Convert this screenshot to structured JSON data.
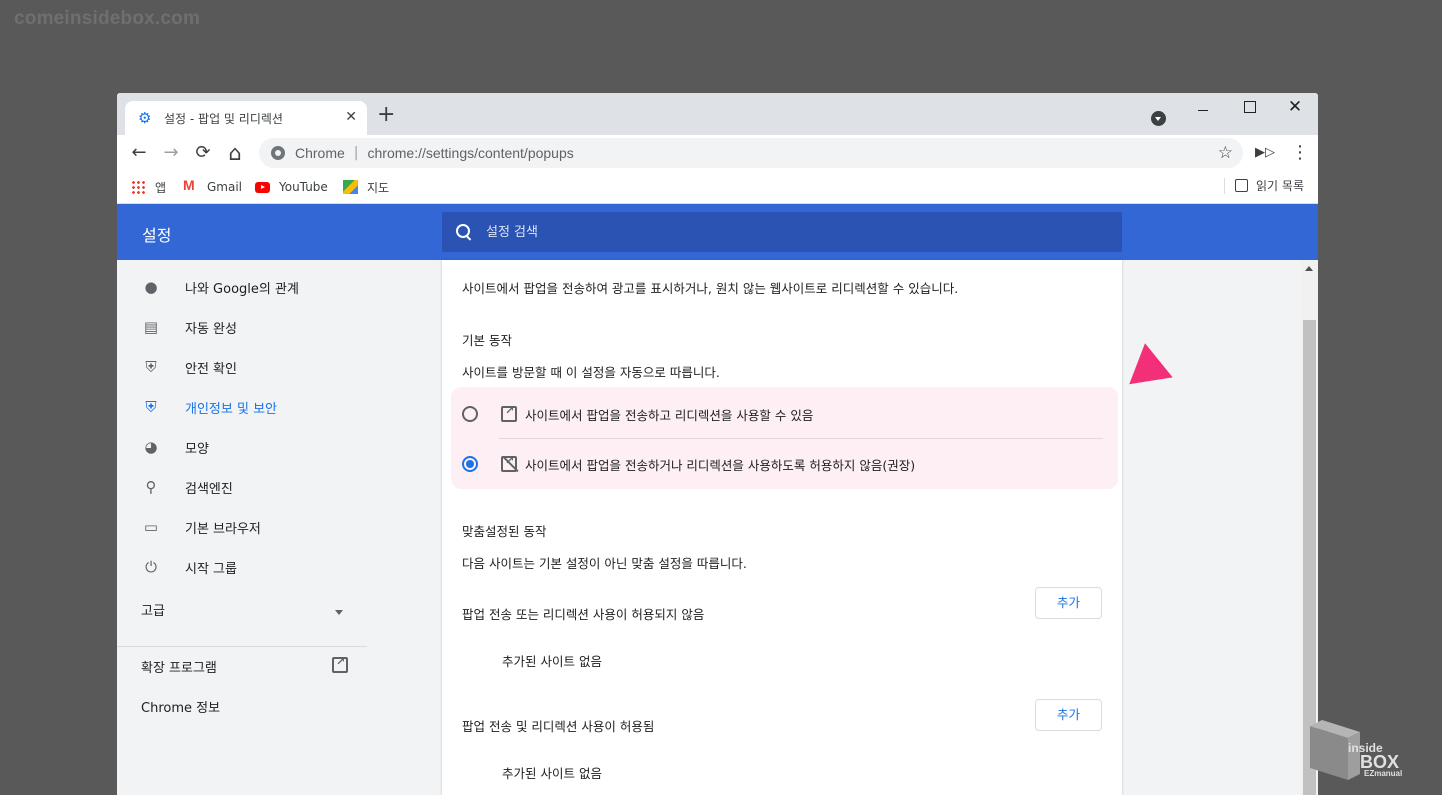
{
  "watermark": "comeinsidebox.com",
  "tab": {
    "title": "설정 - 팝업 및 리디렉션",
    "close": "✕",
    "new_tab": "+"
  },
  "window_controls": {
    "close": "✕"
  },
  "toolbar": {
    "back": "←",
    "forward": "→",
    "reload": "⟳",
    "home": "⌂",
    "scheme_label": "Chrome",
    "separator": "|",
    "url": "chrome://settings/content/popups",
    "star": "☆",
    "menu": "⋮"
  },
  "bookmarks": {
    "items": [
      {
        "label": "앱",
        "icon": "apps-icon"
      },
      {
        "label": "Gmail",
        "icon": "gmail-icon"
      },
      {
        "label": "YouTube",
        "icon": "youtube-icon"
      },
      {
        "label": "지도",
        "icon": "maps-icon"
      }
    ],
    "reading_list": "읽기 목록"
  },
  "header": {
    "title": "설정",
    "search_placeholder": "설정 검색"
  },
  "sidebar": {
    "items": [
      {
        "label": "나와 Google의 관계",
        "icon": "👤",
        "active": false
      },
      {
        "label": "자동 완성",
        "icon": "📋",
        "active": false
      },
      {
        "label": "안전 확인",
        "icon": "🛡",
        "active": false
      },
      {
        "label": "개인정보 및 보안",
        "icon": "🛡",
        "active": true
      },
      {
        "label": "모양",
        "icon": "🎨",
        "active": false
      },
      {
        "label": "검색엔진",
        "icon": "🔍",
        "active": false
      },
      {
        "label": "기본 브라우저",
        "icon": "▭",
        "active": false
      },
      {
        "label": "시작 그룹",
        "icon": "⏻",
        "active": false
      }
    ],
    "advanced": "고급",
    "extensions": "확장 프로그램",
    "about": "Chrome 정보"
  },
  "main": {
    "description": "사이트에서 팝업을 전송하여 광고를 표시하거나, 원치 않는 웹사이트로 리디렉션할 수 있습니다.",
    "default_heading": "기본 동작",
    "default_desc": "사이트를 방문할 때 이 설정을 자동으로 따릅니다.",
    "options": [
      {
        "label": "사이트에서 팝업을 전송하고 리디렉션을 사용할 수 있음",
        "checked": false
      },
      {
        "label": "사이트에서 팝업을 전송하거나 리디렉션을 사용하도록 허용하지 않음(권장)",
        "checked": true
      }
    ],
    "custom_heading": "맞춤설정된 동작",
    "custom_desc": "다음 사이트는 기본 설정이 아닌 맞춤 설정을 따릅니다.",
    "blocked_section": {
      "title": "팝업 전송 또는 리디렉션 사용이 허용되지 않음",
      "add_label": "추가",
      "empty": "추가된 사이트 없음"
    },
    "allowed_section": {
      "title": "팝업 전송 및 리디렉션 사용이 허용됨",
      "add_label": "추가",
      "empty": "추가된 사이트 없음"
    }
  },
  "logo": {
    "line1": "inside",
    "line2": "BOX",
    "line3": "EZmanual"
  },
  "colors": {
    "header": "#3367d6",
    "accent": "#1a73e8",
    "highlight": "#fdeff3",
    "pointer": "#f42f7a"
  }
}
